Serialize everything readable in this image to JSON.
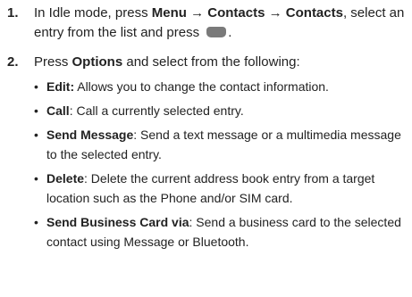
{
  "steps": [
    {
      "number": "1.",
      "parts": {
        "t1": "In Idle mode, press ",
        "menu": "Menu",
        "arrow1": " → ",
        "contacts1": "Contacts",
        "arrow2": "  → ",
        "contacts2": "Contacts",
        "t2": ", select an entry from the list and press ",
        "t3": "."
      },
      "key_icon": "center-soft-key-icon"
    },
    {
      "number": "2.",
      "parts": {
        "t1": "Press ",
        "options": "Options",
        "t2": " and select from the following:"
      }
    }
  ],
  "options": [
    {
      "title": "Edit:",
      "text": " Allows you to change the contact information."
    },
    {
      "title": "Call",
      "text": ": Call a currently selected entry."
    },
    {
      "title": "Send Message",
      "text": ": Send a text message or a multimedia message to the selected entry."
    },
    {
      "title": "Delete",
      "text": ": Delete the current address book entry from a target location such as the Phone and/or SIM card."
    },
    {
      "title": "Send Business Card via",
      "text": ": Send a business card to the selected contact using Message or Bluetooth."
    }
  ]
}
